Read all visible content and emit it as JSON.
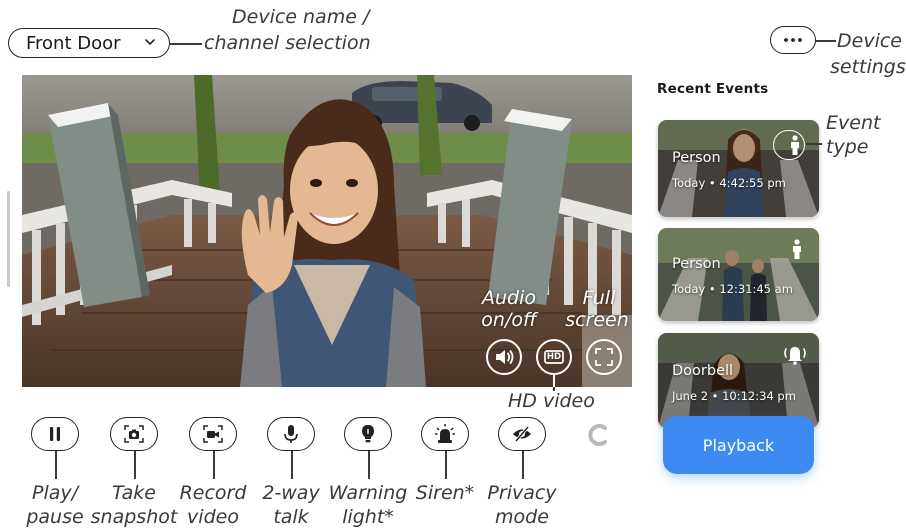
{
  "header": {
    "device_name": "Front Door",
    "device_annotation": [
      "Device name /",
      "channel selection"
    ],
    "settings_annotation": [
      "Device",
      "settings"
    ]
  },
  "video_overlay": {
    "audio_annotation": [
      "Audio",
      "on/off"
    ],
    "fullscreen_annotation": [
      "Full",
      "screen"
    ],
    "hd_label": "HD",
    "hd_annotation": "HD video"
  },
  "controls": [
    {
      "id": "play-pause",
      "icon": "pause-icon",
      "annotation": [
        "Play/",
        "pause"
      ]
    },
    {
      "id": "snapshot",
      "icon": "camera-icon",
      "annotation": [
        "Take",
        "snapshot"
      ]
    },
    {
      "id": "record",
      "icon": "video-camera-icon",
      "annotation": [
        "Record",
        "video"
      ]
    },
    {
      "id": "talk",
      "icon": "microphone-icon",
      "annotation": [
        "2-way",
        "talk"
      ]
    },
    {
      "id": "warning-light",
      "icon": "light-bulb-icon",
      "annotation": [
        "Warning",
        "light*"
      ]
    },
    {
      "id": "siren",
      "icon": "siren-icon",
      "annotation": [
        "Siren*"
      ]
    },
    {
      "id": "privacy",
      "icon": "eye-off-icon",
      "annotation": [
        "Privacy",
        "mode"
      ]
    }
  ],
  "side_panel": {
    "title": "Recent Events",
    "event_type_annotation": [
      "Event",
      "type"
    ],
    "events": [
      {
        "type": "Person",
        "time": "Today • 4:42:55 pm",
        "icon": "person-icon"
      },
      {
        "type": "Person",
        "time": "Today • 12:31:45 am",
        "icon": "person-icon"
      },
      {
        "type": "Doorbell",
        "time": "June 2 • 10:12:34 pm",
        "icon": "bell-ringing-icon"
      }
    ],
    "playback_label": "Playback"
  },
  "colors": {
    "accent": "#3d8bf2",
    "annotation_text": "#3a3a3a",
    "outline": "#222222"
  }
}
